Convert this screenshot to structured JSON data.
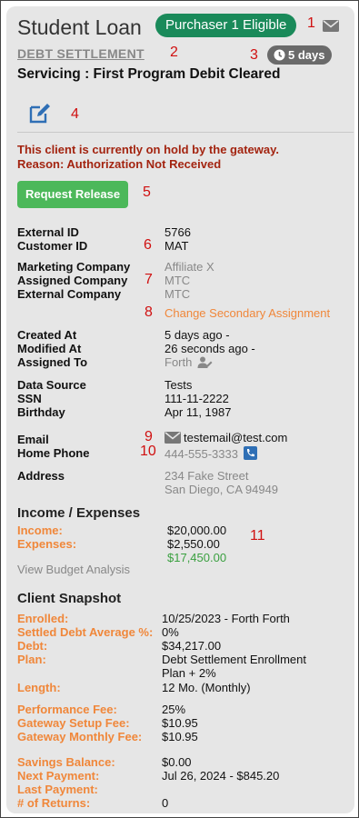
{
  "header": {
    "title": "Student Loan",
    "eligibility_badge": "Purchaser 1 Eligible",
    "program_link": "DEBT SETTLEMENT",
    "days_badge": "5 days",
    "servicing": "Servicing : First Program Debit Cleared"
  },
  "markers": [
    "1",
    "2",
    "3",
    "4",
    "5",
    "6",
    "7",
    "8",
    "9",
    "10",
    "11"
  ],
  "hold": {
    "line1": "This client is currently on hold by the gateway.",
    "line2": "Reason: Authorization Not Received",
    "button": "Request Release"
  },
  "ids": {
    "external_id_label": "External ID",
    "external_id": "5766",
    "customer_id_label": "Customer ID",
    "customer_id": "MAT"
  },
  "companies": {
    "marketing_label": "Marketing Company",
    "marketing": "Affiliate X",
    "assigned_label": "Assigned Company",
    "assigned": "MTC",
    "external_label": "External Company",
    "external": "MTC",
    "change_link": "Change Secondary Assignment"
  },
  "dates": {
    "created_label": "Created At",
    "created": "5 days ago -",
    "modified_label": "Modified At",
    "modified": "26 seconds ago -",
    "assigned_label": "Assigned To",
    "assigned": "Forth"
  },
  "source": {
    "data_source_label": "Data Source",
    "data_source": "Tests",
    "ssn_label": "SSN",
    "ssn": "111-11-2222",
    "birthday_label": "Birthday",
    "birthday": "Apr 11, 1987"
  },
  "contact": {
    "email_label": "Email",
    "email": "testemail@test.com",
    "phone_label": "Home Phone",
    "phone": "444-555-3333",
    "address_label": "Address",
    "address1": "234 Fake Street",
    "address2": "San Diego, CA 94949"
  },
  "income": {
    "heading": "Income / Expenses",
    "income_label": "Income:",
    "income": "$20,000.00",
    "expenses_label": "Expenses:",
    "expenses": "$2,550.00",
    "net": "$17,450.00",
    "budget_link": "View Budget Analysis"
  },
  "snapshot": {
    "heading": "Client Snapshot",
    "enrolled_label": "Enrolled:",
    "enrolled": "10/25/2023 - Forth Forth",
    "settled_label": "Settled Debt Average %:",
    "settled": "0%",
    "debt_label": "Debt:",
    "debt": "$34,217.00",
    "plan_label": "Plan:",
    "plan1": "Debt Settlement Enrollment",
    "plan2": "Plan + 2%",
    "length_label": "Length:",
    "length": "12 Mo. (Monthly)",
    "perf_fee_label": "Performance Fee:",
    "perf_fee": "25%",
    "setup_fee_label": "Gateway Setup Fee:",
    "setup_fee": "$10.95",
    "monthly_fee_label": "Gateway Monthly Fee:",
    "monthly_fee": "$10.95",
    "savings_label": "Savings Balance:",
    "savings": "$0.00",
    "next_payment_label": "Next Payment:",
    "next_payment": "Jul 26, 2024 - $845.20",
    "last_payment_label": "Last Payment:",
    "returns_label": "# of Returns:",
    "returns": "0"
  }
}
